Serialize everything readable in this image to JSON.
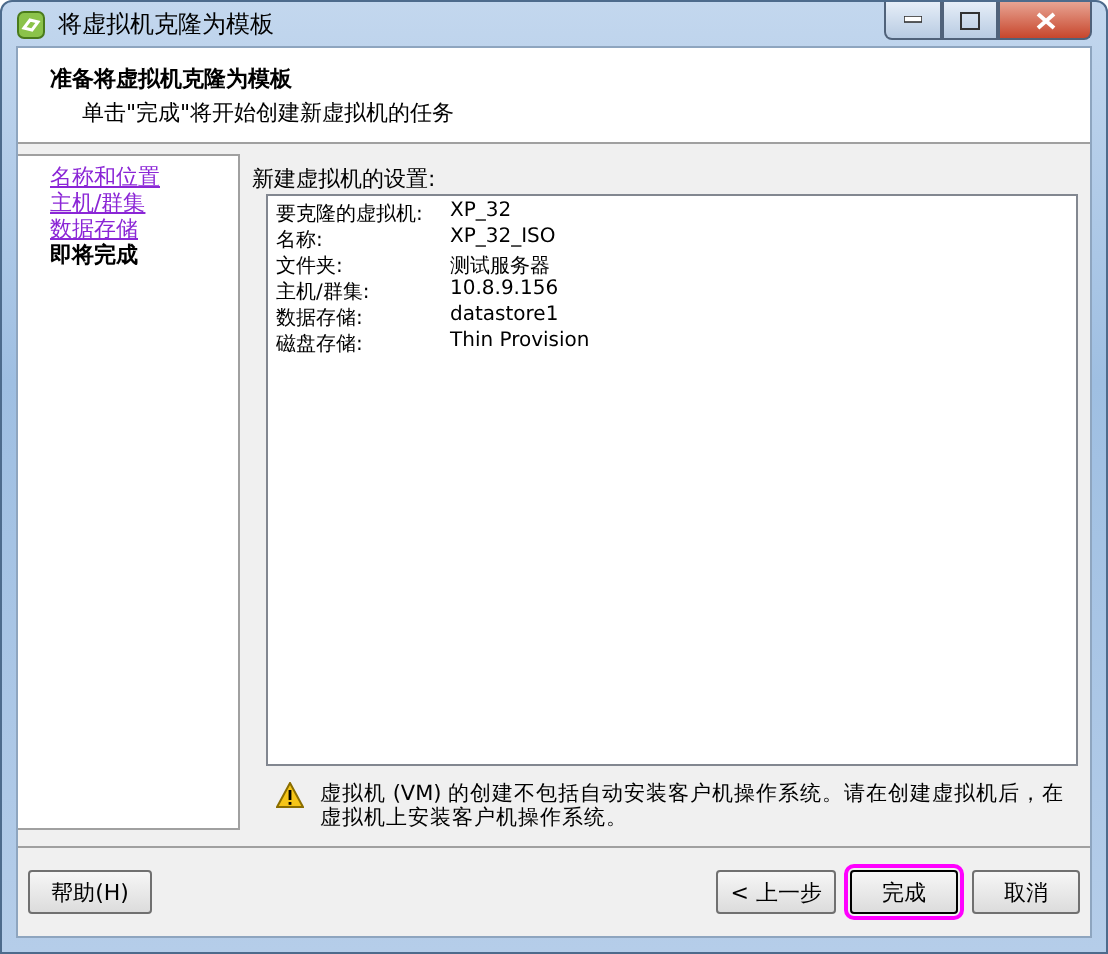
{
  "window": {
    "title": "将虚拟机克隆为模板"
  },
  "header": {
    "title": "准备将虚拟机克隆为模板",
    "subtitle": "单击\"完成\"将开始创建新虚拟机的任务"
  },
  "steps": [
    {
      "label": "名称和位置",
      "selected": false
    },
    {
      "label": "主机/群集",
      "selected": false
    },
    {
      "label": "数据存储",
      "selected": false
    },
    {
      "label": "即将完成",
      "selected": true
    }
  ],
  "settings": {
    "title": "新建虚拟机的设置:",
    "rows": [
      {
        "label": "要克隆的虚拟机:",
        "value": "XP_32"
      },
      {
        "label": "名称:",
        "value": "XP_32_ISO"
      },
      {
        "label": "文件夹:",
        "value": "测试服务器"
      },
      {
        "label": "主机/群集:",
        "value": "10.8.9.156"
      },
      {
        "label": "数据存储:",
        "value": "datastore1"
      },
      {
        "label": "磁盘存储:",
        "value": "Thin Provision"
      }
    ]
  },
  "warning": "虚拟机 (VM) 的创建不包括自动安装客户机操作系统。请在创建虚拟机后，在虚拟机上安装客户机操作系统。",
  "buttons": [
    {
      "label": "帮助(H)",
      "highlighted": false
    },
    {
      "label": "< 上一步",
      "highlighted": false
    },
    {
      "label": "完成",
      "highlighted": true
    },
    {
      "label": "取消",
      "highlighted": false
    }
  ]
}
